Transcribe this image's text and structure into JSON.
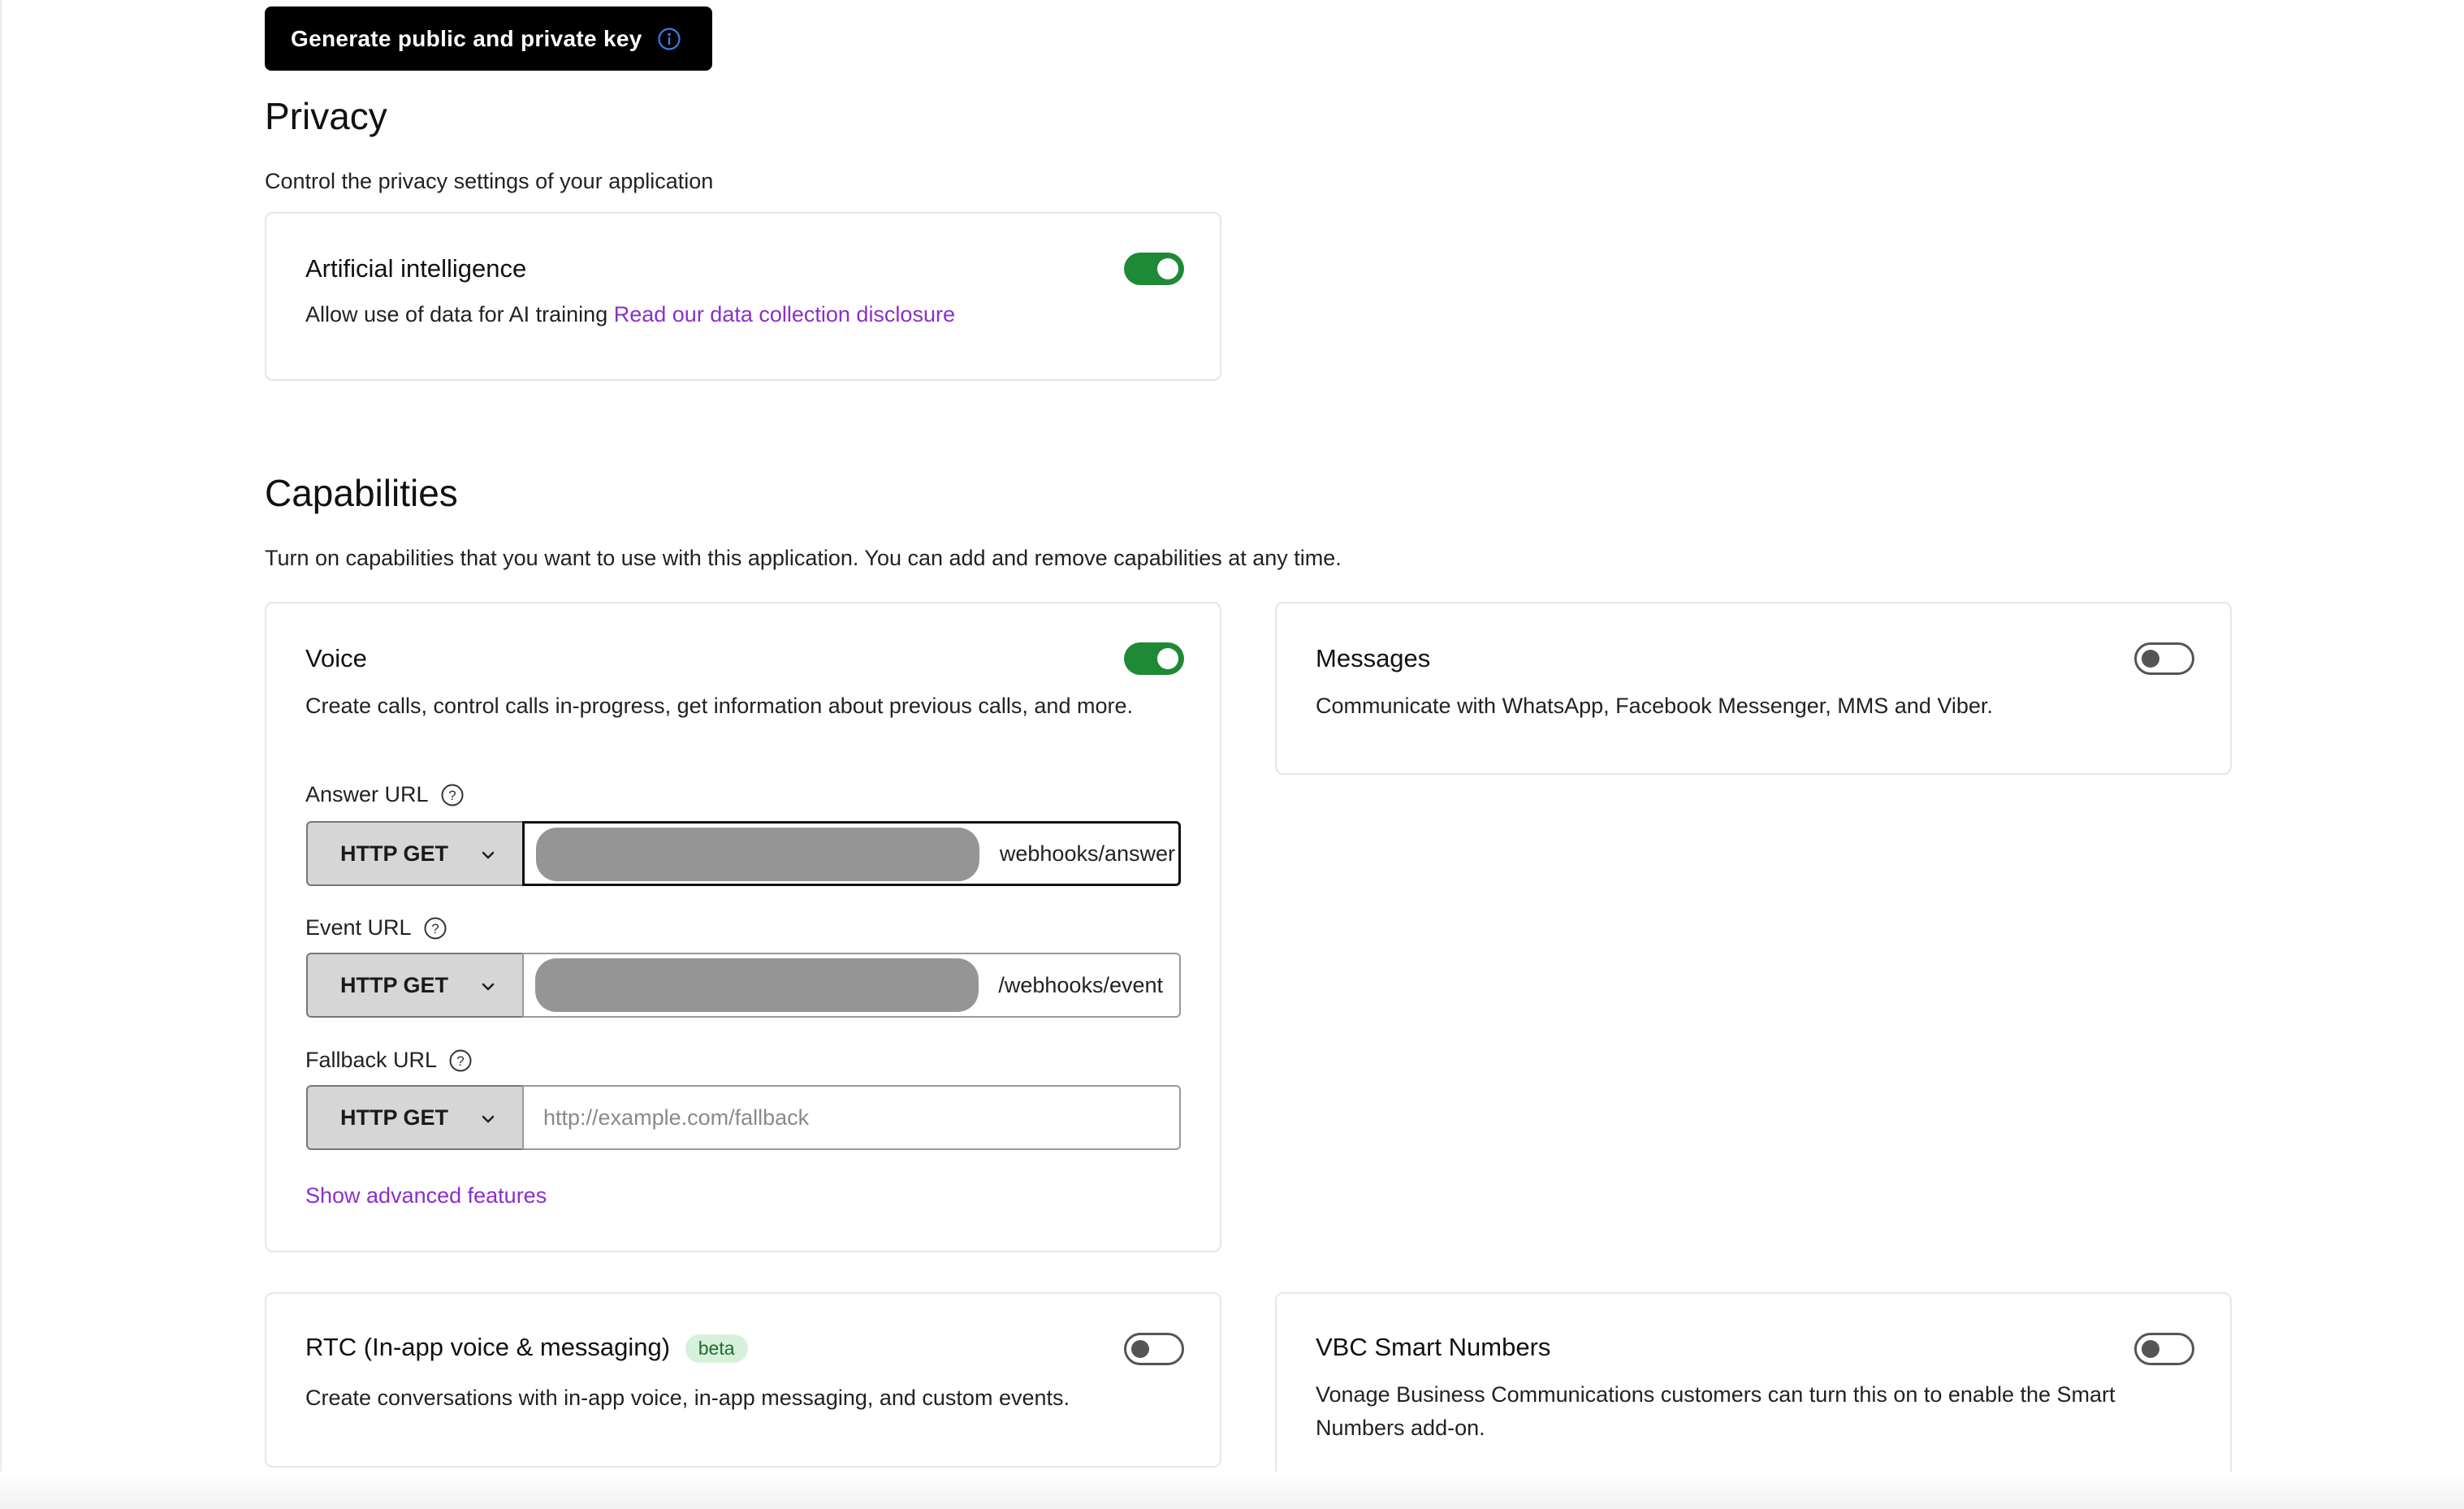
{
  "keys": {
    "generate_label": "Generate public and private key"
  },
  "privacy": {
    "title": "Privacy",
    "subtitle": "Control the privacy settings of your application",
    "ai": {
      "title": "Artificial intelligence",
      "desc": "Allow use of data for AI training",
      "link": "Read our data collection disclosure",
      "enabled": true
    }
  },
  "capabilities": {
    "title": "Capabilities",
    "subtitle": "Turn on capabilities that you want to use with this application. You can add and remove capabilities at any time.",
    "voice": {
      "title": "Voice",
      "desc": "Create calls, control calls in-progress, get information about previous calls, and more.",
      "enabled": true,
      "answer_url": {
        "label": "Answer URL",
        "method": "HTTP GET",
        "value_suffix": "webhooks/answer"
      },
      "event_url": {
        "label": "Event URL",
        "method": "HTTP GET",
        "value_suffix": "/webhooks/event"
      },
      "fallback_url": {
        "label": "Fallback URL",
        "method": "HTTP GET",
        "placeholder": "http://example.com/fallback"
      },
      "advanced_link": "Show advanced features"
    },
    "messages": {
      "title": "Messages",
      "desc": "Communicate with WhatsApp, Facebook Messenger, MMS and Viber.",
      "enabled": false
    },
    "rtc": {
      "title": "RTC (In-app voice & messaging)",
      "badge": "beta",
      "desc": "Create conversations with in-app voice, in-app messaging, and custom events.",
      "enabled": false
    },
    "vbc": {
      "title": "VBC Smart Numbers",
      "desc": "Vonage Business Communications customers can turn this on to enable the Smart Numbers add-on.",
      "enabled": false
    }
  },
  "colors": {
    "toggle_on": "#1f8a35",
    "link": "#8b2fc9",
    "primary_button": "#000000",
    "beta_badge_bg": "#d7f0dc"
  },
  "icons": {
    "info": "info-circle-icon",
    "help": "question-circle-icon",
    "dropdown": "chevron-down-icon"
  }
}
